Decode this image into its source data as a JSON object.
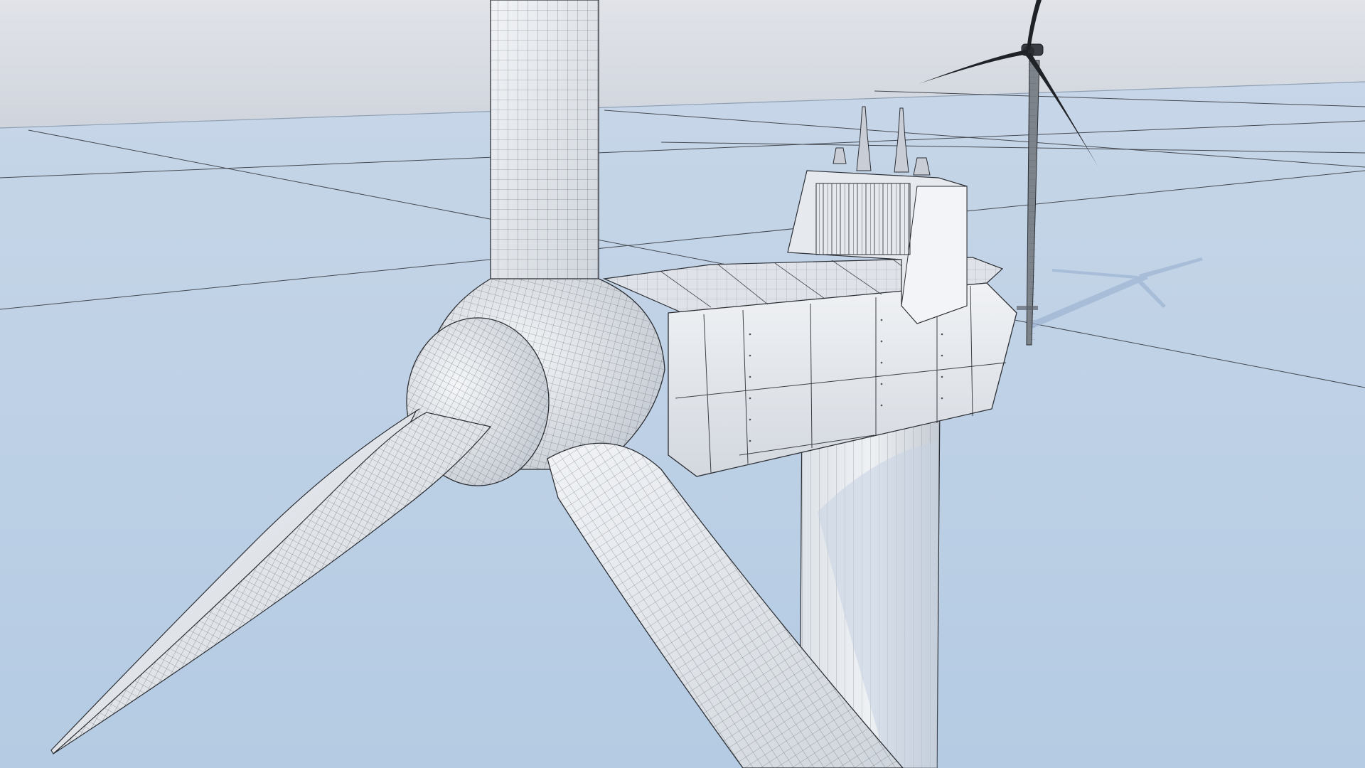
{
  "scene": {
    "description_hidden": "",
    "colors": {
      "sky": "#d9dce3",
      "sky_horizon": "#cfd5de",
      "ground": "#bcd0e6",
      "ground_light": "#cddcec",
      "mesh_fill": "#e9ecf0",
      "mesh_shade": "#c9ced6",
      "wire": "#2b2e33",
      "background_turbine": "#1f2226",
      "shadow": "#9fb7d3"
    },
    "icons": [
      "wind-turbine-model",
      "background-wind-turbine",
      "turbine-shadow"
    ]
  }
}
